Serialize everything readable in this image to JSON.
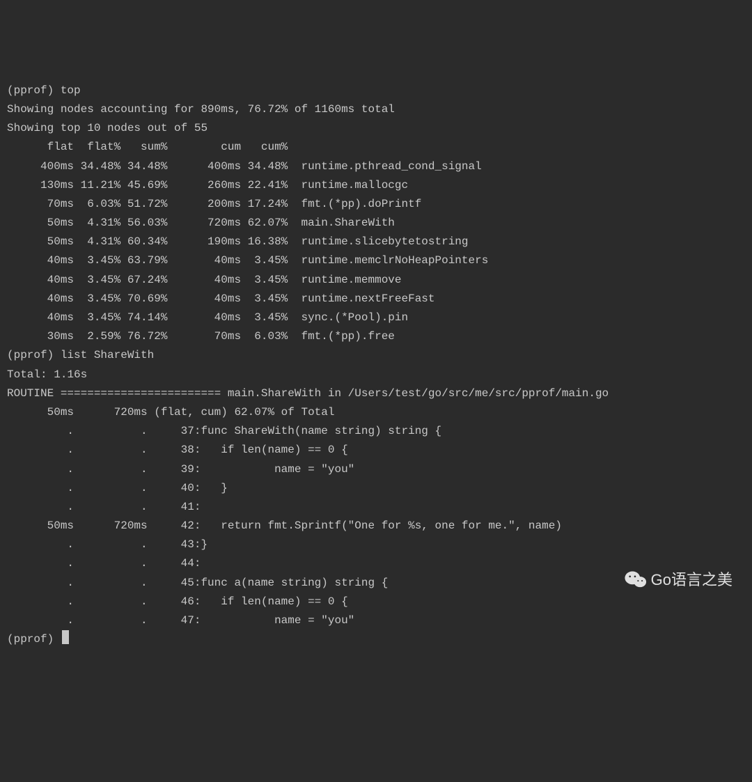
{
  "prompt_prefix": "(pprof) ",
  "commands": {
    "top": "top",
    "list": "list ShareWith"
  },
  "top_output": {
    "summary_line1": "Showing nodes accounting for 890ms, 76.72% of 1160ms total",
    "summary_line2": "Showing top 10 nodes out of 55",
    "header": {
      "flat": "flat",
      "flat_pct": "flat%",
      "sum_pct": "sum%",
      "cum": "cum",
      "cum_pct": "cum%"
    },
    "rows": [
      {
        "flat": "400ms",
        "flat_pct": "34.48%",
        "sum_pct": "34.48%",
        "cum": "400ms",
        "cum_pct": "34.48%",
        "fn": "runtime.pthread_cond_signal"
      },
      {
        "flat": "130ms",
        "flat_pct": "11.21%",
        "sum_pct": "45.69%",
        "cum": "260ms",
        "cum_pct": "22.41%",
        "fn": "runtime.mallocgc"
      },
      {
        "flat": "70ms",
        "flat_pct": "6.03%",
        "sum_pct": "51.72%",
        "cum": "200ms",
        "cum_pct": "17.24%",
        "fn": "fmt.(*pp).doPrintf"
      },
      {
        "flat": "50ms",
        "flat_pct": "4.31%",
        "sum_pct": "56.03%",
        "cum": "720ms",
        "cum_pct": "62.07%",
        "fn": "main.ShareWith"
      },
      {
        "flat": "50ms",
        "flat_pct": "4.31%",
        "sum_pct": "60.34%",
        "cum": "190ms",
        "cum_pct": "16.38%",
        "fn": "runtime.slicebytetostring"
      },
      {
        "flat": "40ms",
        "flat_pct": "3.45%",
        "sum_pct": "63.79%",
        "cum": "40ms",
        "cum_pct": "3.45%",
        "fn": "runtime.memclrNoHeapPointers"
      },
      {
        "flat": "40ms",
        "flat_pct": "3.45%",
        "sum_pct": "67.24%",
        "cum": "40ms",
        "cum_pct": "3.45%",
        "fn": "runtime.memmove"
      },
      {
        "flat": "40ms",
        "flat_pct": "3.45%",
        "sum_pct": "70.69%",
        "cum": "40ms",
        "cum_pct": "3.45%",
        "fn": "runtime.nextFreeFast"
      },
      {
        "flat": "40ms",
        "flat_pct": "3.45%",
        "sum_pct": "74.14%",
        "cum": "40ms",
        "cum_pct": "3.45%",
        "fn": "sync.(*Pool).pin"
      },
      {
        "flat": "30ms",
        "flat_pct": "2.59%",
        "sum_pct": "76.72%",
        "cum": "70ms",
        "cum_pct": "6.03%",
        "fn": "fmt.(*pp).free"
      }
    ]
  },
  "list_output": {
    "total_line": "Total: 1.16s",
    "routine_line": "ROUTINE ======================== main.ShareWith in /Users/test/go/src/me/src/pprof/main.go",
    "summary": {
      "flat": "50ms",
      "cum": "720ms",
      "tail": "(flat, cum) 62.07% of Total"
    },
    "source_lines": [
      {
        "flat": ".",
        "cum": ".",
        "lineno": "37",
        "code": "func ShareWith(name string) string {"
      },
      {
        "flat": ".",
        "cum": ".",
        "lineno": "38",
        "code": "   if len(name) == 0 {"
      },
      {
        "flat": ".",
        "cum": ".",
        "lineno": "39",
        "code": "           name = \"you\""
      },
      {
        "flat": ".",
        "cum": ".",
        "lineno": "40",
        "code": "   }"
      },
      {
        "flat": ".",
        "cum": ".",
        "lineno": "41",
        "code": ""
      },
      {
        "flat": "50ms",
        "cum": "720ms",
        "lineno": "42",
        "code": "   return fmt.Sprintf(\"One for %s, one for me.\", name)"
      },
      {
        "flat": ".",
        "cum": ".",
        "lineno": "43",
        "code": "}"
      },
      {
        "flat": ".",
        "cum": ".",
        "lineno": "44",
        "code": ""
      },
      {
        "flat": ".",
        "cum": ".",
        "lineno": "45",
        "code": "func a(name string) string {"
      },
      {
        "flat": ".",
        "cum": ".",
        "lineno": "46",
        "code": "   if len(name) == 0 {"
      },
      {
        "flat": ".",
        "cum": ".",
        "lineno": "47",
        "code": "           name = \"you\""
      }
    ]
  },
  "watermark_text": "Go语言之美"
}
